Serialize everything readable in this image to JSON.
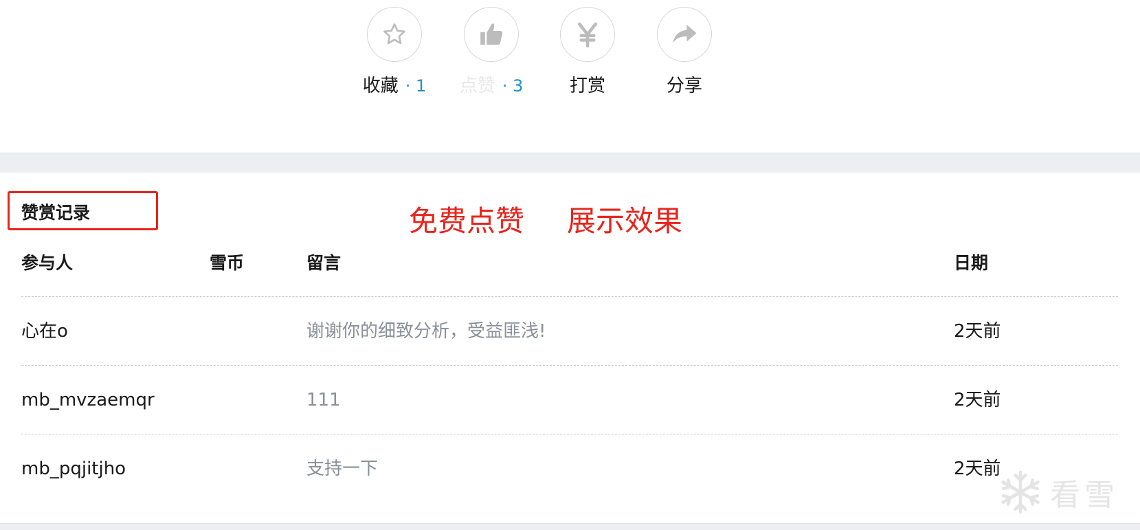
{
  "actions": [
    {
      "label": "收藏",
      "count": "· 1",
      "icon": "star-icon"
    },
    {
      "label": "点赞",
      "count": "· 3",
      "icon": "thumbs-up-icon"
    },
    {
      "label": "打赏",
      "icon": "yen-icon"
    },
    {
      "label": "分享",
      "icon": "share-arrow-icon"
    }
  ],
  "reward_section": {
    "title": "赞赏记录",
    "annotation_left": "免费点赞",
    "annotation_right": "展示效果",
    "columns": {
      "participant": "参与人",
      "coins": "雪币",
      "message": "留言",
      "date": "日期"
    },
    "rows": [
      {
        "participant": "心在o",
        "coins": "",
        "message": "谢谢你的细致分析，受益匪浅!",
        "date": "2天前"
      },
      {
        "participant": "mb_mvzaemqr",
        "coins": "",
        "message": "111",
        "date": "2天前"
      },
      {
        "participant": "mb_pqjitjho",
        "coins": "",
        "message": "支持一下",
        "date": "2天前"
      }
    ]
  },
  "watermark": {
    "text": "看雪"
  },
  "colors": {
    "accent_blue": "#1a8fd0",
    "annotation_red": "#e8251c",
    "muted_text": "#8a9099"
  }
}
